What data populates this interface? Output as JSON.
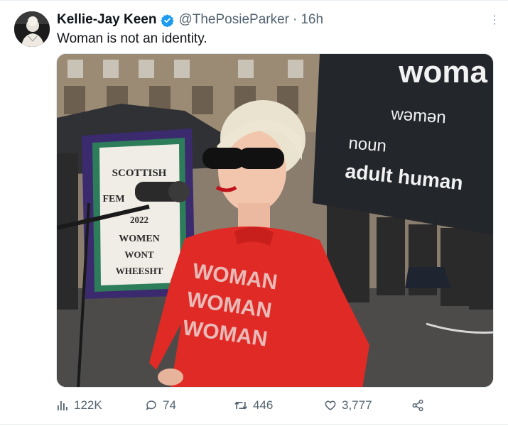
{
  "tweet": {
    "author_name": "Kellie-Jay Keen",
    "handle": "@ThePosieParker",
    "separator": "·",
    "time": "16h",
    "text": "Woman is not an identity.",
    "more_label": "⋮"
  },
  "media": {
    "banner_title": "woma",
    "banner_word": "wəmən",
    "banner_pos": "noun",
    "banner_def": "adult human",
    "sign_line1": "SCOTTISH",
    "sign_line2": "FEM",
    "sign_line3": "2022",
    "sign_line4": "WOMEN",
    "sign_line5": "WONT",
    "sign_line6": "WHEESHT",
    "shirt_word": "WOMAN"
  },
  "actions": {
    "views": "122K",
    "replies": "74",
    "retweets": "446",
    "likes": "3,777"
  },
  "colors": {
    "verified": "#1d9bf0",
    "muted": "#536471",
    "shirt_red": "#e02a26",
    "banner_black": "#23262b",
    "sign_purple": "#3b2a6e"
  }
}
